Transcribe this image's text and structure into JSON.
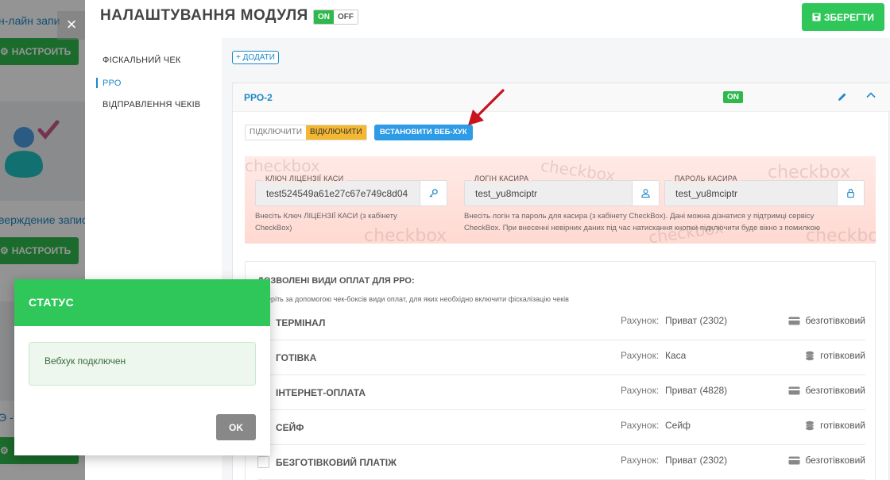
{
  "background": {
    "item1_text": "н-лайн запи",
    "configure_label": "НАСТРОИТЬ",
    "item2_text": "верждение запис",
    "item3_text": "Э - "
  },
  "module": {
    "title": "НАЛАШТУВАННЯ МОДУЛЯ",
    "toggle_on": "ON",
    "toggle_off": "OFF",
    "save_label": "ЗБЕРЕГТИ"
  },
  "nav": {
    "items": [
      {
        "label": "ФІСКАЛЬНИЙ ЧЕК"
      },
      {
        "label": "РРО"
      },
      {
        "label": "ВІДПРАВЛЕННЯ ЧЕКІВ"
      }
    ]
  },
  "content": {
    "add_label": "+ ДОДАТИ"
  },
  "rro": {
    "name": "РРО-2",
    "status": "ON",
    "connect_label": "ПІДКЛЮЧИТИ",
    "disconnect_label": "ВІДКЛЮЧИТИ",
    "webhook_label": "ВСТАНОВИТИ ВЕБ-ХУК",
    "watermark": "checkbox",
    "license": {
      "label": "КЛЮЧ ЛІЦЕНЗІЇ КАСИ",
      "value": "test524549a61e27c67e749c8d04",
      "hint_line1": "Внесіть Ключ ЛІЦЕНЗІЇ КАСИ (з кабінету",
      "hint_line2": "CheckBox)"
    },
    "login": {
      "label": "ЛОГІН КАСИРА",
      "value": "test_yu8mciptr"
    },
    "password": {
      "label": "ПАРОЛЬ КАСИРА",
      "value": "test_yu8mciptr"
    },
    "cred_hint_line1": "Внесіть логін та пароль для касира (з кабінету CheckBox). Дані можна дізнатися у підтримці сервісу",
    "cred_hint_line2": "CheckBox. При внесенні невірних даних під час натискання кнопки підключити буде вікно з помилкою"
  },
  "payments": {
    "title": "ДОЗВОЛЕНІ ВИДИ ОПЛАТ ДЛЯ РРО:",
    "subtitle": "Оберіть за допомогою чек-боксів види оплат, для яких необхідно включити фіскалізацію чеків",
    "account_label": "Рахунок:",
    "rows": [
      {
        "name": "ТЕРМІНАЛ",
        "account": "Приват (2302)",
        "type": "безготівковий",
        "icon": "card-icon"
      },
      {
        "name": "ГОТІВКА",
        "account": "Каса",
        "type": "готівковий",
        "icon": "coins-icon"
      },
      {
        "name": "ІНТЕРНЕТ-ОПЛАТА",
        "account": "Приват (4828)",
        "type": "безготівковий",
        "icon": "card-icon"
      },
      {
        "name": "СЕЙФ",
        "account": "Сейф",
        "type": "готівковий",
        "icon": "coins-icon"
      },
      {
        "name": "БЕЗГОТІВКОВИЙ ПЛАТІЖ",
        "account": "Приват (2302)",
        "type": "безготівковий",
        "icon": "card-icon"
      }
    ]
  },
  "modal": {
    "title": "СТАТУС",
    "message": "Вебхук подключен",
    "ok_label": "OK"
  },
  "colors": {
    "accent_green": "#2fc75a",
    "link_blue": "#1e88c7",
    "warning_yellow": "#f4b731",
    "arrow_red": "#c8141e"
  }
}
